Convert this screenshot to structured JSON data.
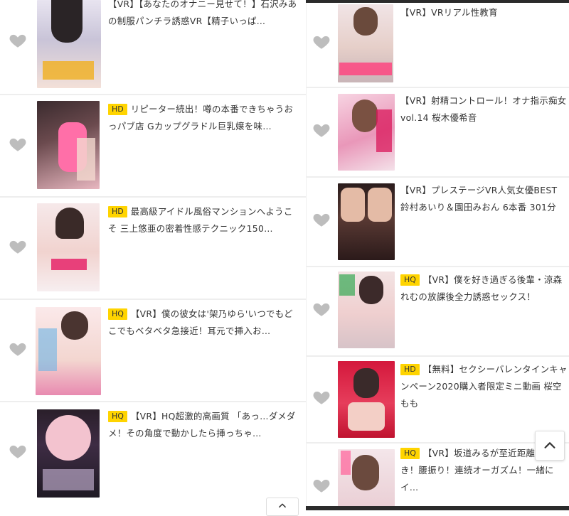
{
  "icons": {
    "favorite": "heart-icon",
    "scroll_top": "chevron-up-icon"
  },
  "colors": {
    "badge": "#ffd400",
    "heart": "#bdbdbd",
    "text": "#333333"
  },
  "left_items": [
    {
      "badge": "",
      "title": "【VR】【あなたのオナニー見せて！】石沢みあの制服パンチラ誘惑VR【精子いっぱ…"
    },
    {
      "badge": "HD",
      "title": "リピーター続出！噂の本番できちゃうおっパブ店 Gカップグラドル巨乳嬢を味…"
    },
    {
      "badge": "HD",
      "title": "最高級アイドル風俗マンションへようこそ 三上悠亜の密着性感テクニック150…"
    },
    {
      "badge": "HQ",
      "title": "【VR】僕の彼女は'架乃ゆら'いつでもどこでもベタベタ急接近！耳元で挿入お…"
    },
    {
      "badge": "HQ",
      "title": "【VR】HQ超激的高画質 「あっ…ダメダメ！その角度で動かしたら挿っちゃ…"
    }
  ],
  "right_items": [
    {
      "badge": "",
      "title": "【VR】VRリアル性教育"
    },
    {
      "badge": "",
      "title": "【VR】射精コントロール！オナ指示痴女vol.14 桜木優希音"
    },
    {
      "badge": "",
      "title": "【VR】プレステージVR人気女優BEST 鈴村あいり＆園田みおん 6本番 301分"
    },
    {
      "badge": "HQ",
      "title": "【VR】僕を好き過ぎる後輩・涼森れむの放課後全力誘惑セックス！"
    },
    {
      "badge": "HD",
      "title": "【無料】セクシーバレンタインキャンペーン2020購入者限定ミニ動画 桜空もも"
    },
    {
      "badge": "HQ",
      "title": "【VR】坂道みるが至近距離で囁き！腰振り！連続オーガズム！一緒にイ…"
    }
  ]
}
